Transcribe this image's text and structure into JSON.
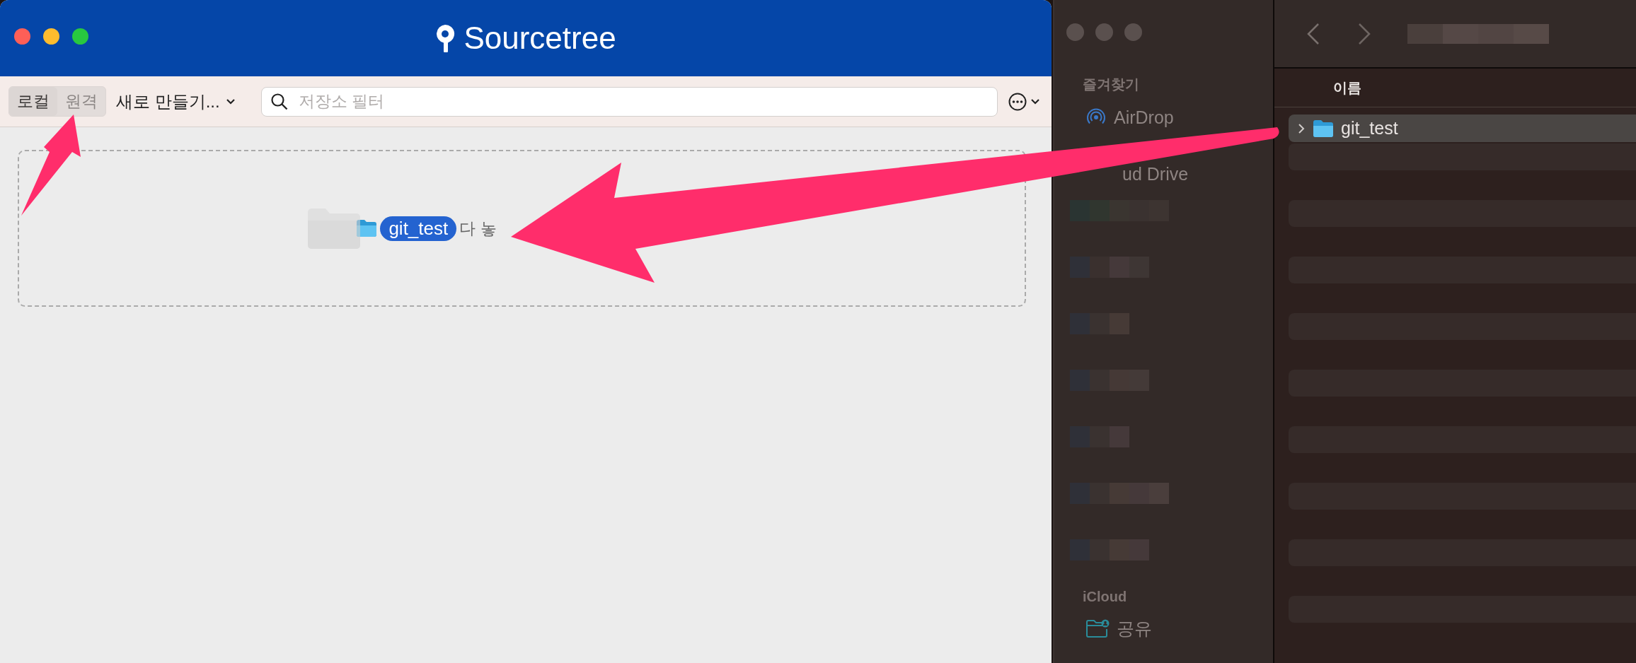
{
  "sourcetree": {
    "title": "Sourcetree",
    "tabs": [
      {
        "label": "로컬",
        "selected": true
      },
      {
        "label": "원격",
        "selected": false
      }
    ],
    "new_menu": "새로 만들기...",
    "search": {
      "placeholder": "저장소 필터"
    },
    "drop_zone": {
      "hint": "다 놓",
      "drag_badge": "git_test"
    }
  },
  "finder": {
    "sidebar": {
      "sections": [
        {
          "title": "즐겨찾기",
          "items": [
            {
              "label": "AirDrop",
              "kind": "airdrop"
            },
            {
              "label": "ud Drive",
              "kind": "plain"
            }
          ]
        },
        {
          "title": "iCloud",
          "items": [
            {
              "label": "공유",
              "kind": "shared"
            }
          ]
        }
      ]
    },
    "column_header": "이름",
    "rows": [
      {
        "name": "git_test",
        "selected": true
      }
    ]
  }
}
